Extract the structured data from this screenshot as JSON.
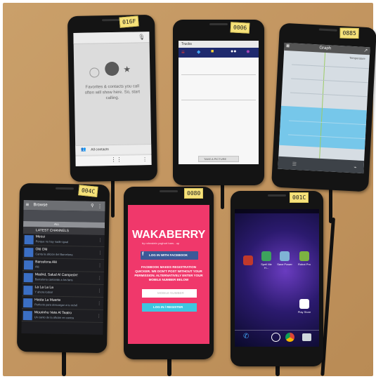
{
  "phones": {
    "p016f": {
      "label": "016F",
      "empty_text": "Favorites & contacts you call often will show here. So, start calling.",
      "all_contacts": "All contacts"
    },
    "p0006": {
      "label": "0006",
      "app_title": "Trucks",
      "take_picture": "TAKE A PICTURE"
    },
    "p0885": {
      "label": "0885",
      "app_title": "Graph",
      "overlay": "Temperature"
    },
    "p004c": {
      "label": "004C",
      "app_title": "Browse",
      "tab_all": "ALL",
      "channels_header": "LATEST CHANNELS",
      "rows": [
        {
          "title": "Messi",
          "sub": "Porque no hay nadie igual"
        },
        {
          "title": "Olé Olé",
          "sub": "Canta la afición del Barcelona"
        },
        {
          "title": "Barcelona Alé",
          "sub": "Alé"
        },
        {
          "title": "Madrid, Salud Al Campeón!",
          "sub": "Barcelona cantando a los fans"
        },
        {
          "title": "La La La La",
          "sub": "Y ahora todos!"
        },
        {
          "title": "Hasta La Muerte",
          "sub": "Perfecto para descargar a tu móvil"
        },
        {
          "title": "Mourinho Vete Al Teatro",
          "sub": "Un canto de la afición en contra"
        }
      ]
    },
    "p0080": {
      "label": "0080",
      "brand": "WAKABERRY",
      "tagline": "by rohnstein yoghurt bars - up",
      "fb_button": "LOG IN WITH FACEBOOK",
      "notice": "FACEBOOK MAKES REGISTRATION QUICKER. WE DON'T POST WITHOUT YOUR PERMISSION. ALTERNATIVELY ENTER YOUR MOBILE NUMBER BELOW",
      "input_placeholder": "MOBILE NUMBER",
      "login_button": "LOG IN / REGISTER"
    },
    "p001c": {
      "label": "001C",
      "apps": [
        {
          "name": "",
          "color": "#c0392b"
        },
        {
          "name": "Spell Me H...",
          "color": "#3da35d"
        },
        {
          "name": "Save Power",
          "color": "#7fb3d5"
        },
        {
          "name": "Robot Pro",
          "color": "#7cb342"
        }
      ],
      "play_store": "Play Store"
    }
  },
  "colors": {
    "wakaberry_bg": "#f0386b",
    "facebook_blue": "#3b5998",
    "login_cyan": "#3ec6e0",
    "graph_blue": "#76c7ea",
    "browse_header": "#6d6f73"
  }
}
